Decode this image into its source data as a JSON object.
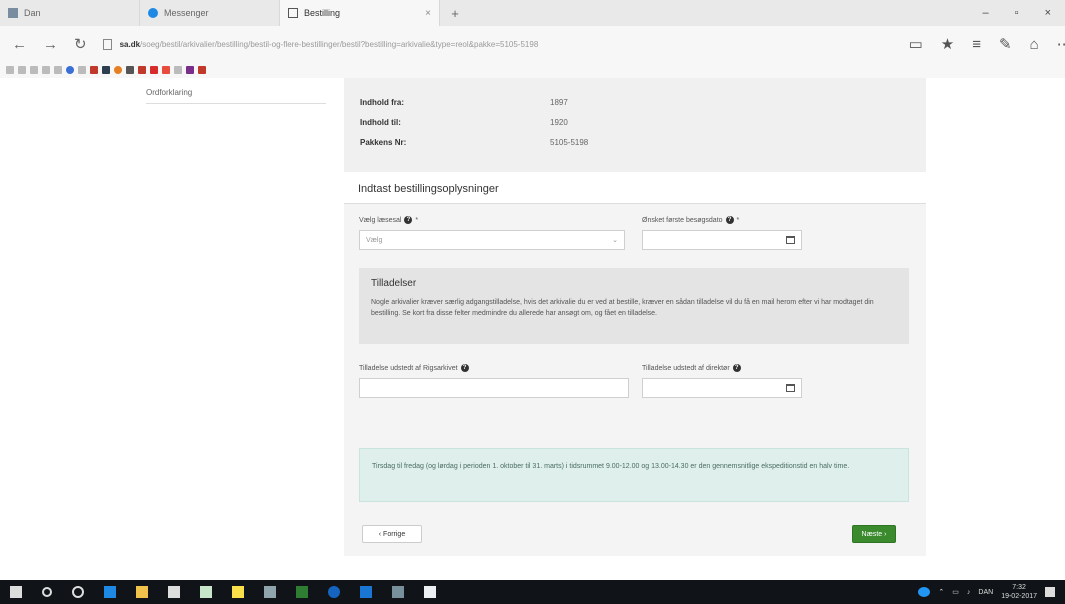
{
  "browser": {
    "tabs": [
      {
        "label": "Dan",
        "color": "#7a8ca0"
      },
      {
        "label": "Messenger",
        "color": "#1e88e5"
      },
      {
        "label": "Bestilling",
        "color": "#555555"
      }
    ],
    "new_tab": "+",
    "window_controls": {
      "minimize": "–",
      "maximize": "▫",
      "close": "×"
    },
    "nav": {
      "back": "←",
      "forward": "→",
      "refresh": "↻"
    },
    "url_host": "sa.dk",
    "url_rest": "/soeg/bestil/arkivalier/bestilling/bestil-og-flere-bestillinger/bestil?bestilling=arkivalie&type=reol&pakke=5105-5198"
  },
  "sidebar": {
    "link": "Ordforklaring"
  },
  "info": [
    {
      "label": "Indhold fra:",
      "value": "1897"
    },
    {
      "label": "Indhold til:",
      "value": "1920"
    },
    {
      "label": "Pakkens Nr:",
      "value": "5105-5198"
    }
  ],
  "section_title": "Indtast bestillingsoplysninger",
  "form": {
    "reading_room_label": "Vælg læsesal",
    "reading_room_value": "Vælg",
    "date_label": "Ønsket første besøgsdato",
    "notice_title": "Tilladelser",
    "notice_text": "Nogle arkivalier kræver særlig adgangstilladelse, hvis det arkivalie du er ved at bestille, kræver en sådan tilladelse vil du få en mail herom efter vi har modtaget din bestilling. Se kort fra disse felter medmindre du allerede har ansøgt om, og fået en tilladelse.",
    "permission_label_1": "Tilladelse udstedt af Rigsarkivet",
    "permission_label_2": "Tilladelse udstedt af direktør",
    "alert_text": "Tirsdag til fredag (og lørdag i perioden 1. oktober til 31. marts) i tidsrummet 9.00-12.00 og 13.00-14.30 er den gennemsnitlige ekspeditionstid en halv time.",
    "back_label": "‹ Forrige",
    "next_label": "Næste ›"
  },
  "colors": {
    "next_button": "#3b8a2e",
    "alert_bg": "#dff0ec",
    "panel_bg": "#f4f4f4"
  },
  "taskbar": {
    "time": "7:32",
    "date": "19-02-2017",
    "lang": "DAN"
  }
}
